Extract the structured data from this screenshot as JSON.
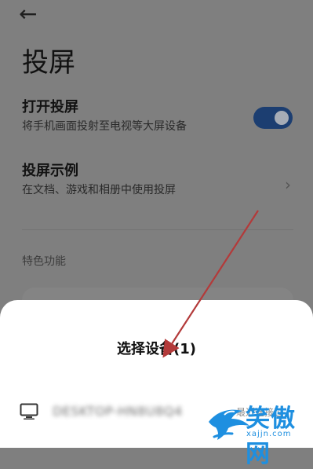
{
  "screen": {
    "title": "投屏",
    "back_icon": "←"
  },
  "settings": {
    "open_cast": {
      "title": "打开投屏",
      "description": "将手机画面投射至电视等大屏设备",
      "enabled": true
    },
    "cast_examples": {
      "title": "投屏示例",
      "description": "在文档、游戏和相册中使用投屏",
      "chevron": "›"
    },
    "section_header": "特色功能"
  },
  "sheet": {
    "title": "选择设备(1)",
    "device": {
      "name": "DESKTOP-HN8U8Q4",
      "status": "最近连接过",
      "icon": "monitor-icon"
    }
  },
  "watermark": {
    "title": "笑傲网",
    "subtitle": "xajjn.com"
  },
  "colors": {
    "overlay_gray": "#7f7f7f",
    "toggle_blue": "#1c3e71",
    "watermark_blue": "#1e8fe0",
    "annotation_red": "#b33a3a"
  }
}
